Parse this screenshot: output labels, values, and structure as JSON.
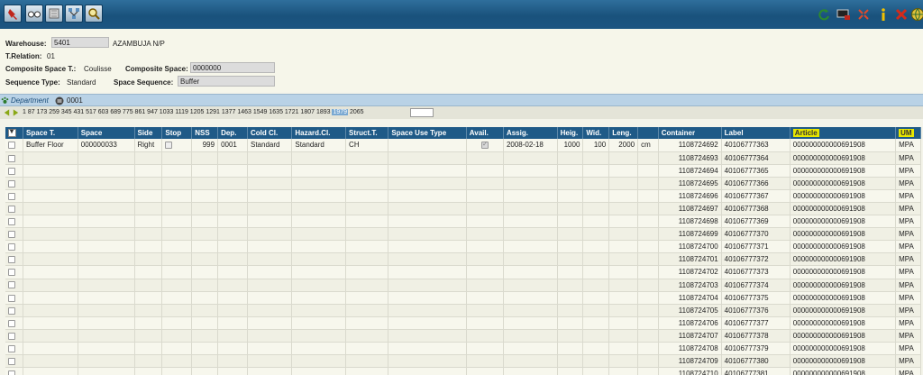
{
  "toolbar": {
    "left_icons": [
      "pin-icon",
      "glasses-icon",
      "book-icon",
      "network-icon",
      "magnifier-icon"
    ],
    "right_icons": [
      "refresh-icon",
      "monitor-icon",
      "expand-icon",
      "info-icon",
      "close-icon",
      "globe-icon"
    ]
  },
  "form": {
    "warehouse_label": "Warehouse:",
    "warehouse_value": "5401",
    "warehouse_name": "AZAMBUJA N/P",
    "trelation_label": "T.Relation:",
    "trelation_value": "01",
    "composite_space_t_label": "Composite Space T.:",
    "composite_space_t_value": "Coulisse",
    "composite_space_label": "Composite Space:",
    "composite_space_value": "0000000",
    "sequence_type_label": "Sequence Type:",
    "sequence_type_value": "Standard",
    "space_sequence_label": "Space Sequence:",
    "space_sequence_value": "Buffer"
  },
  "department": {
    "label": "Department",
    "value": "0001"
  },
  "pager": {
    "pages_before": "1 87 173 259 345 431 517 603 689 775 861 947 1033 1119 1205 1291 1377 1463 1549 1635 1721 1807 1893",
    "current": "1979",
    "pages_after": "2065"
  },
  "table": {
    "headers": [
      "Space T.",
      "Space",
      "Side",
      "Stop",
      "NSS",
      "Dep.",
      "Cold Cl.",
      "Hazard.Cl.",
      "Struct.T.",
      "Space Use Type",
      "Avail.",
      "Assig.",
      "Heig.",
      "Wid.",
      "Leng.",
      "",
      "Container",
      "Label",
      "Article",
      "UM"
    ],
    "first_row": {
      "space_t": "Buffer Floor",
      "space": "000000033",
      "side": "Right",
      "nss": "999",
      "dep": "0001",
      "cold": "Standard",
      "hazard": "Standard",
      "struct": "CH",
      "assig": "2008-02-18",
      "heig": "1000",
      "wid": "100",
      "leng": "2000",
      "unit": "cm"
    },
    "rows": [
      {
        "container": "1108724692",
        "label": "40106777363",
        "article": "000000000000691908",
        "um": "MPA"
      },
      {
        "container": "1108724693",
        "label": "40106777364",
        "article": "000000000000691908",
        "um": "MPA"
      },
      {
        "container": "1108724694",
        "label": "40106777365",
        "article": "000000000000691908",
        "um": "MPA"
      },
      {
        "container": "1108724695",
        "label": "40106777366",
        "article": "000000000000691908",
        "um": "MPA"
      },
      {
        "container": "1108724696",
        "label": "40106777367",
        "article": "000000000000691908",
        "um": "MPA"
      },
      {
        "container": "1108724697",
        "label": "40106777368",
        "article": "000000000000691908",
        "um": "MPA"
      },
      {
        "container": "1108724698",
        "label": "40106777369",
        "article": "000000000000691908",
        "um": "MPA"
      },
      {
        "container": "1108724699",
        "label": "40106777370",
        "article": "000000000000691908",
        "um": "MPA"
      },
      {
        "container": "1108724700",
        "label": "40106777371",
        "article": "000000000000691908",
        "um": "MPA"
      },
      {
        "container": "1108724701",
        "label": "40106777372",
        "article": "000000000000691908",
        "um": "MPA"
      },
      {
        "container": "1108724702",
        "label": "40106777373",
        "article": "000000000000691908",
        "um": "MPA"
      },
      {
        "container": "1108724703",
        "label": "40106777374",
        "article": "000000000000691908",
        "um": "MPA"
      },
      {
        "container": "1108724704",
        "label": "40106777375",
        "article": "000000000000691908",
        "um": "MPA"
      },
      {
        "container": "1108724705",
        "label": "40106777376",
        "article": "000000000000691908",
        "um": "MPA"
      },
      {
        "container": "1108724706",
        "label": "40106777377",
        "article": "000000000000691908",
        "um": "MPA"
      },
      {
        "container": "1108724707",
        "label": "40106777378",
        "article": "000000000000691908",
        "um": "MPA"
      },
      {
        "container": "1108724708",
        "label": "40106777379",
        "article": "000000000000691908",
        "um": "MPA"
      },
      {
        "container": "1108724709",
        "label": "40106777380",
        "article": "000000000000691908",
        "um": "MPA"
      },
      {
        "container": "1108724710",
        "label": "40106777381",
        "article": "000000000000691908",
        "um": "MPA"
      }
    ]
  }
}
